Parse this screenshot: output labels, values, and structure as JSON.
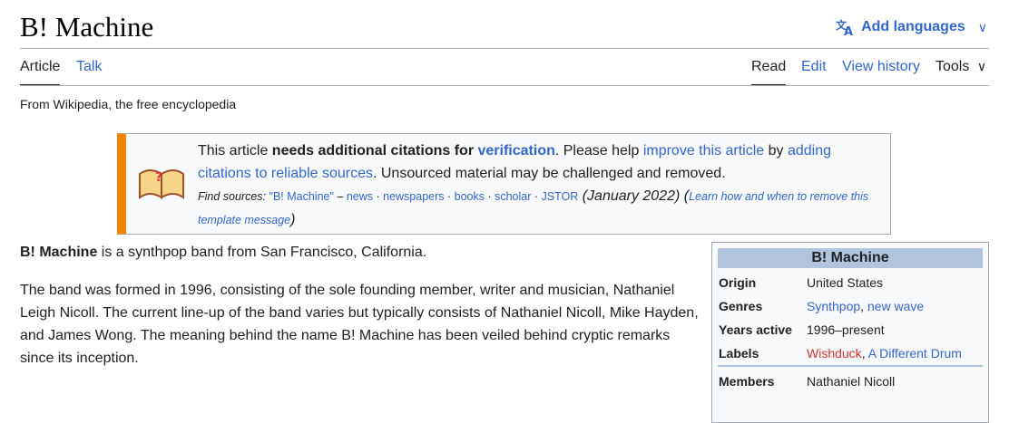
{
  "page": {
    "title": "B! Machine",
    "add_languages": "Add languages",
    "tabs": {
      "article": "Article",
      "talk": "Talk",
      "read": "Read",
      "edit": "Edit",
      "view_history": "View history",
      "tools": "Tools"
    },
    "tagline": "From Wikipedia, the free encyclopedia"
  },
  "ambox": {
    "t1": "This article ",
    "t2": "needs additional citations for ",
    "t3": "verification",
    "t4": ". Please help ",
    "t5": "improve this article",
    "t6": " by ",
    "t7": "adding citations to reliable sources",
    "t8": ". Unsourced material may be challenged and removed.",
    "find_sources": "Find sources: ",
    "q": "\"B! Machine\"",
    "dash": " – ",
    "news": "news",
    "sep": " · ",
    "newspapers": "newspapers",
    "books": "books",
    "scholar": "scholar",
    "jstor": "JSTOR",
    "date": " (January 2022)",
    "open": " (",
    "learn": "Learn how and when to remove this template message",
    "close": ")"
  },
  "body": {
    "p1_bold": "B! Machine",
    "p1_rest": " is a synthpop band from San Francisco, California.",
    "p2": "The band was formed in 1996, consisting of the sole founding member, writer and musician, Nathaniel Leigh Nicoll. The current line-up of the band varies but typically consists of Nathaniel Nicoll, Mike Hayden, and James Wong. The meaning behind the name B! Machine has been veiled behind cryptic remarks since its inception."
  },
  "infobox": {
    "title": "B! Machine",
    "origin_label": "Origin",
    "origin": "United States",
    "genres_label": "Genres",
    "genre1": "Synthpop",
    "genre_sep": ", ",
    "genre2": "new wave",
    "years_label": "Years active",
    "years": "1996–present",
    "labels_label": "Labels",
    "label1": "Wishduck",
    "label_sep": ", ",
    "label2": "A Different Drum",
    "members_label": "Members",
    "members": "Nathaniel Nicoll"
  },
  "colors": {
    "link": "#3366cc",
    "redlink": "#d73333",
    "ambox_accent": "#f28500",
    "infobox_head": "#b0c4de"
  }
}
